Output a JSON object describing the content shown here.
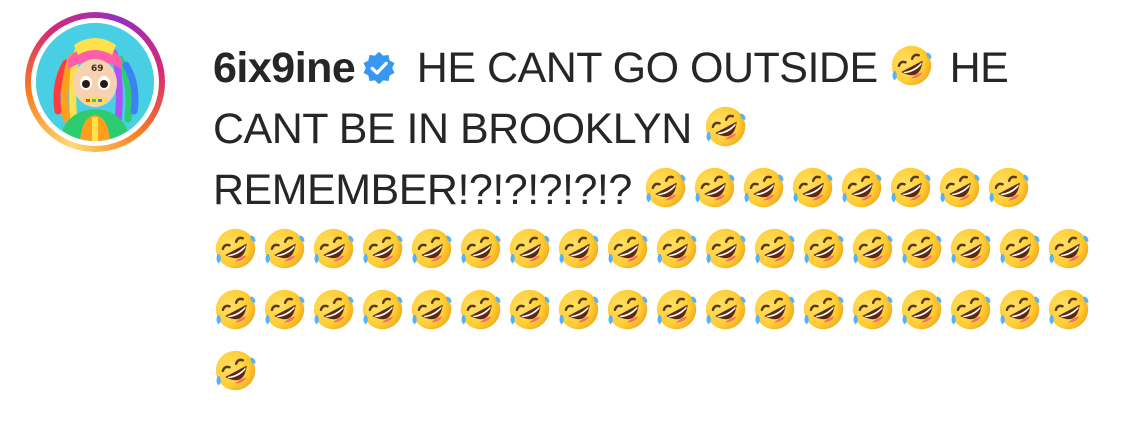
{
  "post": {
    "username": "6ix9ine",
    "avatar_icon": "cartoon-avatar-icon",
    "verified_icon": "verified-badge-icon",
    "verified_color": "#3897f0",
    "caption_text_1": "HE CANT GO OUTSIDE",
    "caption_text_2": "HE CANT BE IN BROOKLYN",
    "caption_text_3": "REMEMBER!?!?!?!?!?",
    "emoji_name": "rolling-on-the-floor-laughing-icon",
    "emoji_counts": {
      "after_text_1": 1,
      "after_text_2": 1,
      "after_text_3": 8,
      "row_4": 18,
      "row_5": 18,
      "row_6": 1
    }
  }
}
